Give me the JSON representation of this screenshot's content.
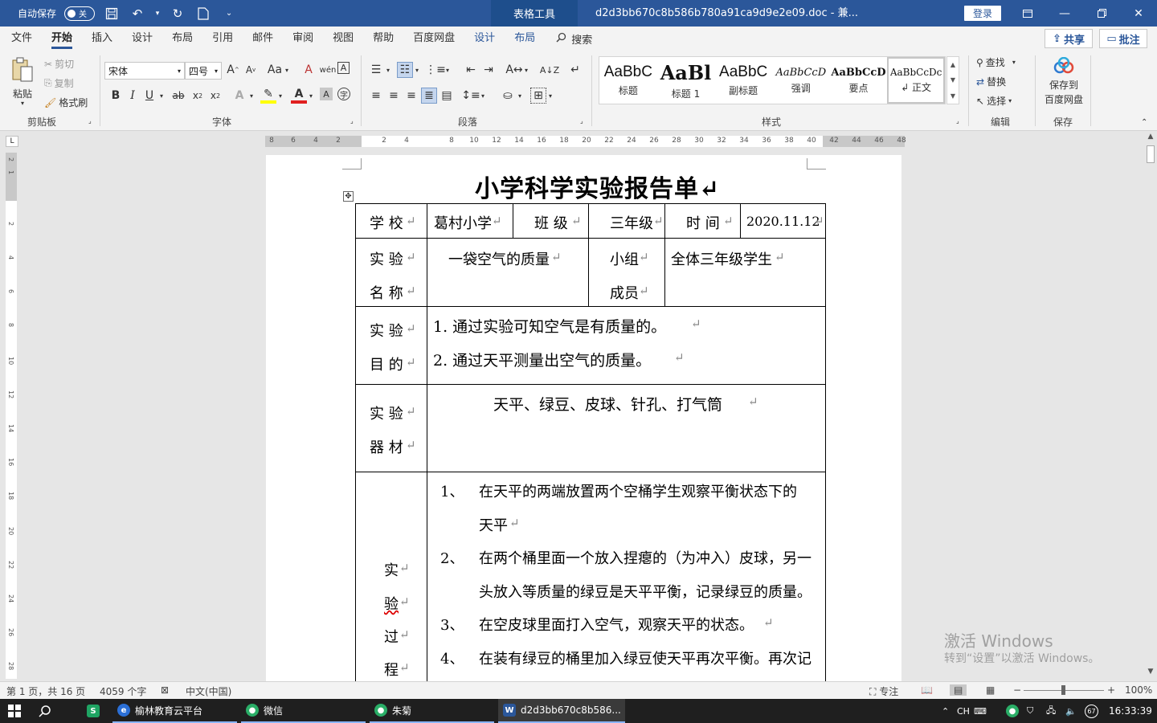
{
  "titlebar": {
    "autosave_label": "自动保存",
    "autosave_state": "关",
    "table_tools": "表格工具",
    "doc_title": "d2d3bb670c8b586b780a91ca9d9e2e09.doc  -  兼...",
    "login": "登录"
  },
  "tabs": [
    "文件",
    "开始",
    "插入",
    "设计",
    "布局",
    "引用",
    "邮件",
    "审阅",
    "视图",
    "帮助",
    "百度网盘",
    "设计",
    "布局"
  ],
  "tab_search": "搜索",
  "share": "共享",
  "comment": "批注",
  "clipboard": {
    "paste": "粘贴",
    "cut": "剪切",
    "copy": "复制",
    "format_painter": "格式刷",
    "label": "剪贴板"
  },
  "font": {
    "name": "宋体",
    "size": "四号",
    "label": "字体"
  },
  "paragraph_label": "段落",
  "styles": {
    "label": "样式",
    "items": [
      {
        "preview": "AaBbC",
        "name": "标题"
      },
      {
        "preview": "AaBl",
        "name": "标题 1"
      },
      {
        "preview": "AaBbC",
        "name": "副标题"
      },
      {
        "preview": "AaBbCcD",
        "name": "强调"
      },
      {
        "preview": "AaBbCcD",
        "name": "要点"
      },
      {
        "preview": "AaBbCcDc",
        "name": "↲ 正文"
      }
    ]
  },
  "editing": {
    "find": "查找",
    "replace": "替换",
    "select": "选择",
    "label": "编辑"
  },
  "save": {
    "save_to": "保存到",
    "baidu": "百度网盘",
    "label": "保存"
  },
  "ruler": {
    "h_numbers": [
      "8",
      "6",
      "4",
      "2",
      "2",
      "4",
      "8",
      "10",
      "12",
      "14",
      "16",
      "18",
      "20",
      "22",
      "24",
      "26",
      "28",
      "30",
      "32",
      "34",
      "36",
      "38",
      "40",
      "42",
      "44",
      "46",
      "48"
    ],
    "v_numbers": [
      "2",
      "1",
      "2",
      "4",
      "6",
      "8",
      "10",
      "12",
      "14",
      "16",
      "18",
      "20",
      "22",
      "24",
      "26",
      "28"
    ]
  },
  "document": {
    "heading": "小学科学实验报告单↵",
    "row1": {
      "school_label": "学  校",
      "school": "葛村小学",
      "class_label": "班  级",
      "class": "三年级",
      "time_label": "时  间",
      "time": "2020.11.12"
    },
    "row2": {
      "name_label_1": "实  验",
      "name_label_2": "名  称",
      "name": "一袋空气的质量",
      "group_label_1": "小组",
      "group_label_2": "成员",
      "group": "全体三年级学生"
    },
    "row3": {
      "label_1": "实  验",
      "label_2": "目  的",
      "items": [
        "1. 通过实验可知空气是有质量的。",
        "2. 通过天平测量出空气的质量。"
      ]
    },
    "row4": {
      "label_1": "实  验",
      "label_2": "器  材",
      "content": "天平、绿豆、皮球、针孔、打气筒"
    },
    "row5": {
      "label_chars": [
        "实",
        "验",
        "过",
        "程"
      ],
      "steps": [
        {
          "num": "1、",
          "line1": "在天平的两端放置两个空桶学生观察平衡状态下的",
          "line2": "天平"
        },
        {
          "num": "2、",
          "line1": "在两个桶里面一个放入捏瘪的（为冲入）皮球，另一",
          "line2": "头放入等质量的绿豆是天平平衡，记录绿豆的质量。"
        },
        {
          "num": "3、",
          "line1": "在空皮球里面打入空气，观察天平的状态。",
          "line2": ""
        },
        {
          "num": "4、",
          "line1": "在装有绿豆的桶里加入绿豆使天平再次平衡。再次记",
          "line2": ""
        }
      ]
    }
  },
  "watermark": {
    "line1": "激活 Windows",
    "line2": "转到“设置”以激活 Windows。"
  },
  "statusbar": {
    "page": "第 1 页，共 16 页",
    "words": "4059 个字",
    "lang": "中文(中国)",
    "focus": "专注",
    "zoom": "100%"
  },
  "taskbar": {
    "apps": [
      {
        "label": "榆林教育云平台"
      },
      {
        "label": "微信"
      },
      {
        "label": "朱菊"
      },
      {
        "label": "d2d3bb670c8b586..."
      }
    ],
    "ime": "CH",
    "battery": "67",
    "time": "16:33:39"
  },
  "colors": {
    "word_blue": "#2b579a",
    "ribbon_bg": "#f3f3f3",
    "taskbar": "#1f1f1f"
  }
}
